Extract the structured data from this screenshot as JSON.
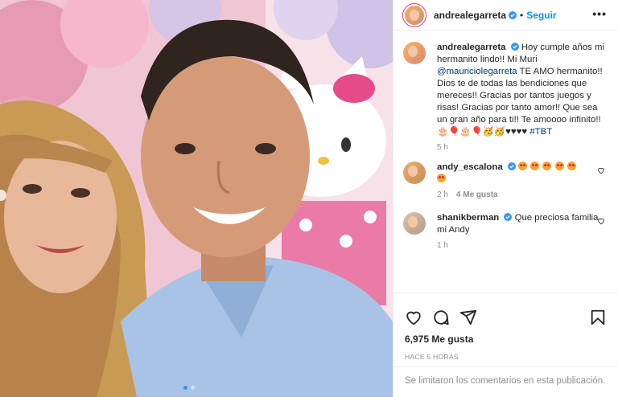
{
  "post": {
    "username": "andrealegarreta",
    "follow_label": "Seguir",
    "more_label": "•••",
    "separator": "•",
    "caption_parts": {
      "text_1": "Hoy cumple años mi hermanito lindo!! Mi Muri ",
      "mention": "@mauriciolegarreta",
      "text_2": " TE AMO hermanito!! Dios te de todas las bendiciones que mereces!! Gracias por tantos juegos y risas! Gracias por tanto amor!! Que sea un gran año para ti!! Te amoooo infinito!! 🎂🎈🎂🎈🥳🥳♥♥♥♥ ",
      "hashtag": "#TBT"
    },
    "caption_time": "5 h",
    "likes": "6,975 Me gusta",
    "timestamp": "HACE 5 HORAS",
    "comments_disabled": "Se limitaron los comentarios en esta publicación."
  },
  "comments": [
    {
      "username": "andy_escalona",
      "emoji_count": 6,
      "time": "2 h",
      "likes": "4 Me gusta"
    },
    {
      "username": "shanikberman",
      "text": "Que preciosa familia mi Andy",
      "time": "1 h"
    }
  ],
  "icons": [
    "heart-icon",
    "comment-icon",
    "share-icon",
    "bookmark-icon",
    "verified-icon",
    "more-icon"
  ],
  "colors": {
    "accent": "#0095f6",
    "verified": "#3897f0",
    "muted": "#8e8e8e",
    "link": "#00376b"
  }
}
